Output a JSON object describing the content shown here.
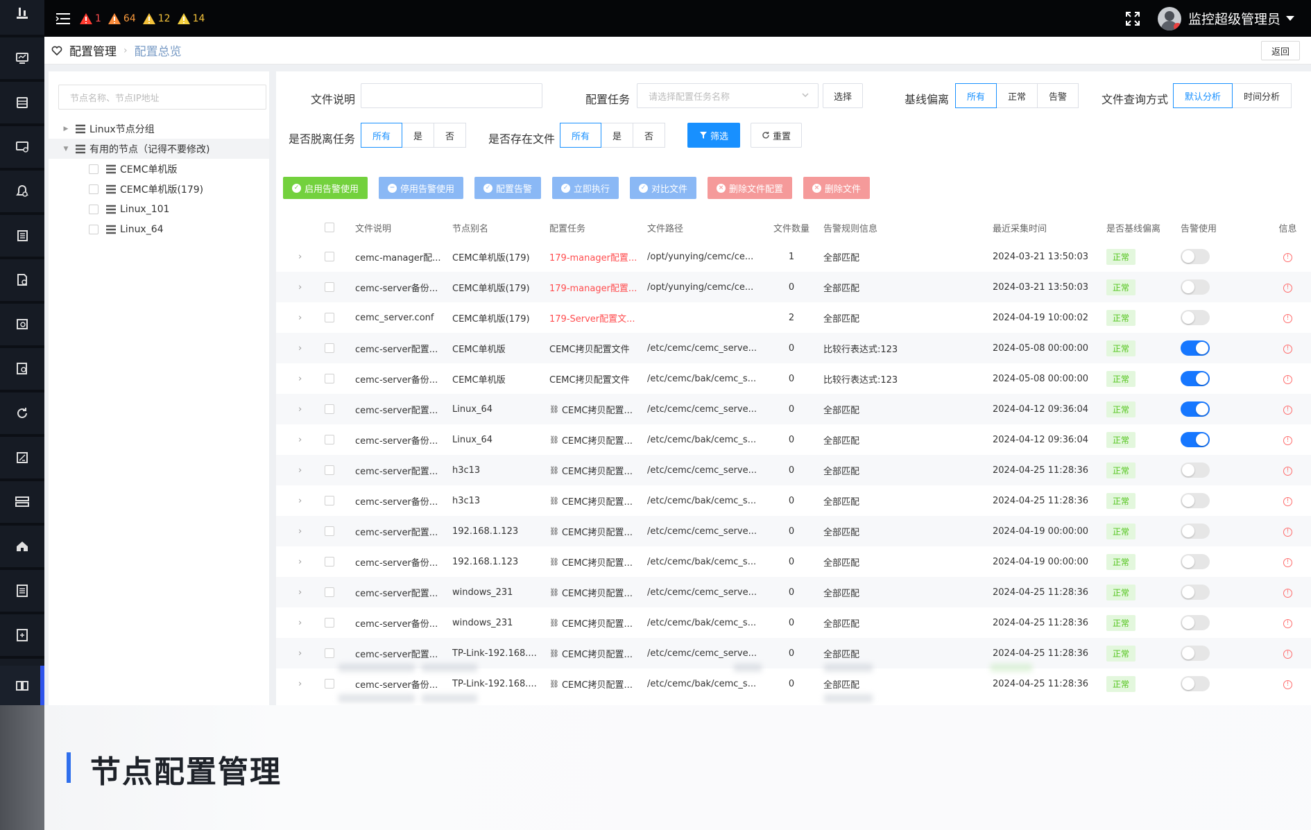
{
  "topbar": {
    "alerts": [
      {
        "count": "1",
        "level": "critical",
        "color": "#ff4d4f"
      },
      {
        "count": "64",
        "level": "major",
        "color": "#fa9a3c"
      },
      {
        "count": "12",
        "level": "minor",
        "color": "#f4c23a"
      },
      {
        "count": "14",
        "level": "warning",
        "color": "#f4c23a"
      }
    ],
    "user": "监控超级管理员"
  },
  "breadcrumb": {
    "root": "配置管理",
    "current": "配置总览",
    "back": "返回"
  },
  "tree": {
    "search_placeholder": "节点名称、节点IP地址",
    "groups": [
      {
        "label": "Linux节点分组",
        "expanded": false
      },
      {
        "label": "有用的节点（记得不要修改)",
        "expanded": true
      }
    ],
    "children": [
      "CEMC单机版",
      "CEMC单机版(179)",
      "Linux_101",
      "Linux_64"
    ]
  },
  "filters": {
    "file_desc_label": "文件说明",
    "config_task_label": "配置任务",
    "config_task_placeholder": "请选择配置任务名称",
    "select_button": "选择",
    "baseline_label": "基线偏离",
    "baseline_options": [
      "所有",
      "正常",
      "告警"
    ],
    "query_mode_label": "文件查询方式",
    "query_mode_options": [
      "默认分析",
      "时间分析"
    ],
    "offline_label": "是否脱离任务",
    "offline_options": [
      "所有",
      "是",
      "否"
    ],
    "exists_label": "是否存在文件",
    "exists_options": [
      "所有",
      "是",
      "否"
    ],
    "filter_button": "筛选",
    "reset_button": "重置"
  },
  "actions": [
    {
      "label": "启用告警使用",
      "color": "#73d13d"
    },
    {
      "label": "停用告警使用",
      "color": "#8ab8f5"
    },
    {
      "label": "配置告警",
      "color": "#8ab8f5"
    },
    {
      "label": "立即执行",
      "color": "#8ab8f5"
    },
    {
      "label": "对比文件",
      "color": "#8ab8f5"
    },
    {
      "label": "删除文件配置",
      "color": "#f59a9a"
    },
    {
      "label": "删除文件",
      "color": "#f59a9a"
    }
  ],
  "table": {
    "headers": [
      "文件说明",
      "节点别名",
      "配置任务",
      "文件路径",
      "文件数量",
      "告警规则信息",
      "最近采集时间",
      "是否基线偏离",
      "告警使用",
      "信息"
    ],
    "rows": [
      {
        "desc": "cemc-manager配...",
        "node": "CEMC单机版(179)",
        "task": "179-manager配置...",
        "task_red": true,
        "task_link": false,
        "path": "/opt/yunying/cemc/ce...",
        "count": "1",
        "rule": "全部匹配",
        "time": "2024-03-21 13:50:03",
        "status": "正常",
        "enabled": false
      },
      {
        "desc": "cemc-server备份...",
        "node": "CEMC单机版(179)",
        "task": "179-manager配置...",
        "task_red": true,
        "task_link": false,
        "path": "/opt/yunying/cemc/ce...",
        "count": "0",
        "rule": "全部匹配",
        "time": "2024-03-21 13:50:03",
        "status": "正常",
        "enabled": false
      },
      {
        "desc": "cemc_server.conf",
        "node": "CEMC单机版(179)",
        "task": "179-Server配置文...",
        "task_red": true,
        "task_link": false,
        "path": "",
        "count": "2",
        "rule": "全部匹配",
        "time": "2024-04-19 10:00:02",
        "status": "正常",
        "enabled": false
      },
      {
        "desc": "cemc-server配置...",
        "node": "CEMC单机版",
        "task": "CEMC拷贝配置文件",
        "task_red": false,
        "task_link": false,
        "path": "/etc/cemc/cemc_serve...",
        "count": "0",
        "rule": "比较行表达式:123",
        "time": "2024-05-08 00:00:00",
        "status": "正常",
        "enabled": true
      },
      {
        "desc": "cemc-server备份...",
        "node": "CEMC单机版",
        "task": "CEMC拷贝配置文件",
        "task_red": false,
        "task_link": false,
        "path": "/etc/cemc/bak/cemc_s...",
        "count": "0",
        "rule": "比较行表达式:123",
        "time": "2024-05-08 00:00:00",
        "status": "正常",
        "enabled": true
      },
      {
        "desc": "cemc-server配置...",
        "node": "Linux_64",
        "task": "CEMC拷贝配置...",
        "task_red": false,
        "task_link": true,
        "path": "/etc/cemc/cemc_serve...",
        "count": "0",
        "rule": "全部匹配",
        "time": "2024-04-12 09:36:04",
        "status": "正常",
        "enabled": true
      },
      {
        "desc": "cemc-server备份...",
        "node": "Linux_64",
        "task": "CEMC拷贝配置...",
        "task_red": false,
        "task_link": true,
        "path": "/etc/cemc/bak/cemc_s...",
        "count": "0",
        "rule": "全部匹配",
        "time": "2024-04-12 09:36:04",
        "status": "正常",
        "enabled": true
      },
      {
        "desc": "cemc-server配置...",
        "node": "h3c13",
        "task": "CEMC拷贝配置...",
        "task_red": false,
        "task_link": true,
        "path": "/etc/cemc/cemc_serve...",
        "count": "0",
        "rule": "全部匹配",
        "time": "2024-04-25 11:28:36",
        "status": "正常",
        "enabled": false
      },
      {
        "desc": "cemc-server备份...",
        "node": "h3c13",
        "task": "CEMC拷贝配置...",
        "task_red": false,
        "task_link": true,
        "path": "/etc/cemc/bak/cemc_s...",
        "count": "0",
        "rule": "全部匹配",
        "time": "2024-04-25 11:28:36",
        "status": "正常",
        "enabled": false
      },
      {
        "desc": "cemc-server配置...",
        "node": "192.168.1.123",
        "task": "CEMC拷贝配置...",
        "task_red": false,
        "task_link": true,
        "path": "/etc/cemc/cemc_serve...",
        "count": "0",
        "rule": "全部匹配",
        "time": "2024-04-19 00:00:00",
        "status": "正常",
        "enabled": false
      },
      {
        "desc": "cemc-server备份...",
        "node": "192.168.1.123",
        "task": "CEMC拷贝配置...",
        "task_red": false,
        "task_link": true,
        "path": "/etc/cemc/bak/cemc_s...",
        "count": "0",
        "rule": "全部匹配",
        "time": "2024-04-19 00:00:00",
        "status": "正常",
        "enabled": false
      },
      {
        "desc": "cemc-server配置...",
        "node": "windows_231",
        "task": "CEMC拷贝配置...",
        "task_red": false,
        "task_link": true,
        "path": "/etc/cemc/cemc_serve...",
        "count": "0",
        "rule": "全部匹配",
        "time": "2024-04-25 11:28:36",
        "status": "正常",
        "enabled": false
      },
      {
        "desc": "cemc-server备份...",
        "node": "windows_231",
        "task": "CEMC拷贝配置...",
        "task_red": false,
        "task_link": true,
        "path": "/etc/cemc/bak/cemc_s...",
        "count": "0",
        "rule": "全部匹配",
        "time": "2024-04-25 11:28:36",
        "status": "正常",
        "enabled": false
      },
      {
        "desc": "cemc-server配置...",
        "node": "TP-Link-192.168....",
        "task": "CEMC拷贝配置...",
        "task_red": false,
        "task_link": true,
        "path": "/etc/cemc/cemc_serve...",
        "count": "0",
        "rule": "全部匹配",
        "time": "2024-04-25 11:28:36",
        "status": "正常",
        "enabled": false
      },
      {
        "desc": "cemc-server备份...",
        "node": "TP-Link-192.168....",
        "task": "CEMC拷贝配置...",
        "task_red": false,
        "task_link": true,
        "path": "/etc/cemc/bak/cemc_s...",
        "count": "0",
        "rule": "全部匹配",
        "time": "2024-04-25 11:28:36",
        "status": "正常",
        "enabled": false
      }
    ]
  },
  "footer": {
    "title": "节点配置管理",
    "accent": "#2f6fec"
  },
  "colors": {
    "primary": "#1890ff",
    "sidebar": "#161b24",
    "topbar": "#050608",
    "status_ok": "#52c41a",
    "danger": "#ff4d4f"
  },
  "sidebar_icons": [
    "logo-icon",
    "monitor-icon",
    "list-icon",
    "desktop-icon",
    "alarm-settings-icon",
    "report-icon",
    "document-search-icon",
    "file-search-icon",
    "doc-check-icon",
    "sync-icon",
    "tools-icon",
    "server-icon",
    "home-icon",
    "log-icon",
    "task-icon",
    "config-settings-icon",
    "book-icon"
  ]
}
